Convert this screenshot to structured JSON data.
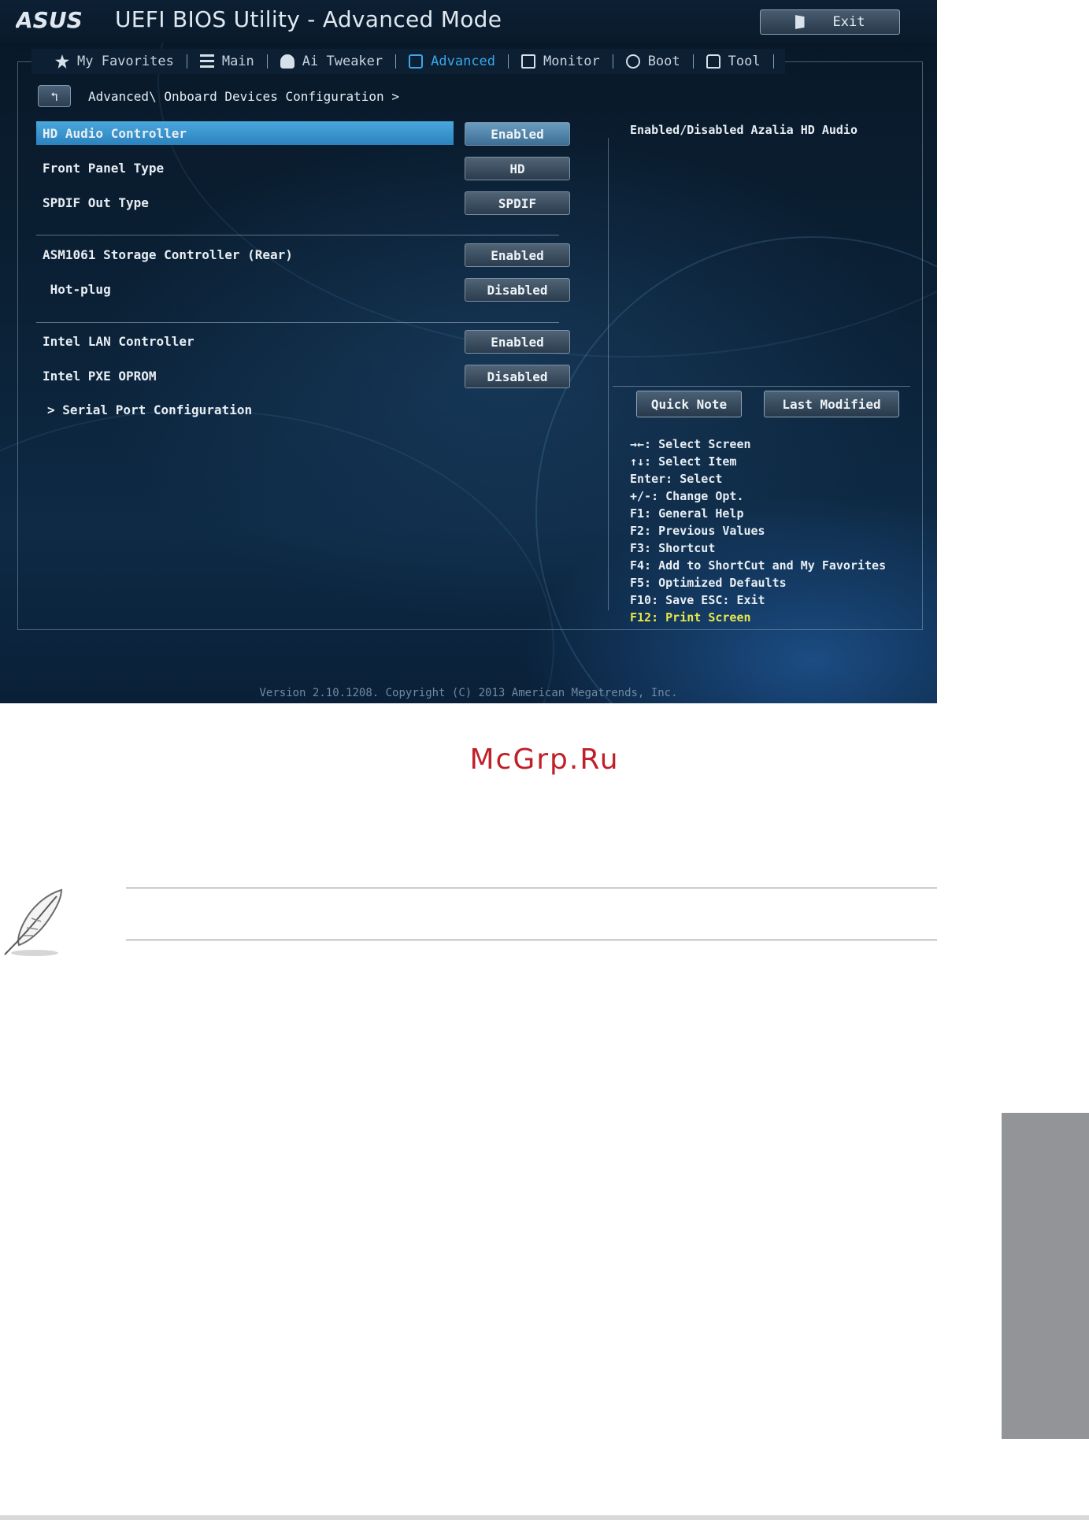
{
  "window": {
    "title": "UEFI BIOS Utility - Advanced Mode",
    "brand": "ASUS",
    "exit_label": "Exit"
  },
  "tabs": [
    {
      "label": "My Favorites",
      "icon": "star-icon"
    },
    {
      "label": "Main",
      "icon": "list-icon"
    },
    {
      "label": "Ai Tweaker",
      "icon": "tweaker-icon"
    },
    {
      "label": "Advanced",
      "icon": "advanced-icon",
      "active": true
    },
    {
      "label": "Monitor",
      "icon": "monitor-icon"
    },
    {
      "label": "Boot",
      "icon": "power-icon"
    },
    {
      "label": "Tool",
      "icon": "tool-icon"
    }
  ],
  "breadcrumb": {
    "back_label": "↰",
    "path": "Advanced\\ Onboard Devices Configuration >"
  },
  "settings": [
    {
      "label": "HD Audio Controller",
      "value": "Enabled",
      "selected": true
    },
    {
      "label": "Front Panel Type",
      "value": "HD"
    },
    {
      "label": "SPDIF Out Type",
      "value": "SPDIF"
    },
    {
      "label": "ASM1061 Storage Controller (Rear)",
      "value": "Enabled"
    },
    {
      "label": " Hot-plug",
      "value": "Disabled"
    },
    {
      "label": "Intel LAN Controller",
      "value": "Enabled"
    },
    {
      "label": "Intel PXE OPROM",
      "value": "Disabled"
    }
  ],
  "submenu": {
    "label": "> Serial Port Configuration"
  },
  "help": {
    "description": "Enabled/Disabled Azalia HD Audio",
    "quick_note": "Quick Note",
    "last_modified": "Last Modified",
    "keys": [
      "→←: Select Screen",
      "↑↓: Select Item",
      "Enter: Select",
      "+/-: Change Opt.",
      "F1: General Help",
      "F2: Previous Values",
      "F3: Shortcut",
      "F4: Add to ShortCut and My Favorites",
      "F5: Optimized Defaults",
      "F10: Save  ESC: Exit"
    ],
    "print_key": "F12: Print Screen"
  },
  "version": "Version 2.10.1208. Copyright (C) 2013 American Megatrends, Inc.",
  "page": {
    "watermark": "McGrp.Ru"
  },
  "colors": {
    "accent": "#39a8e8",
    "highlight": "#2c82bf",
    "watermark": "#c0202a",
    "side_tab": "#929497",
    "key_yellow": "#e8e84a"
  }
}
